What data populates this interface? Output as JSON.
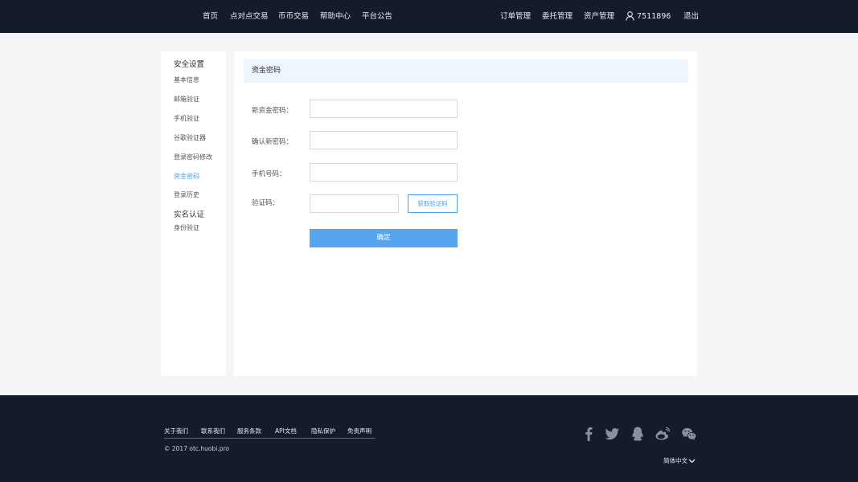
{
  "nav": {
    "left": [
      "首页",
      "点对点交易",
      "币币交易",
      "帮助中心",
      "平台公告"
    ],
    "right": [
      "订单管理",
      "委托管理",
      "资产管理"
    ],
    "user_id": "7511896",
    "logout": "退出"
  },
  "sidebar": {
    "group_security": "安全设置",
    "items": [
      "基本信息",
      "邮箱验证",
      "手机验证",
      "谷歌验证器",
      "登录密码修改",
      "资金密码",
      "登录历史"
    ],
    "active_item": "资金密码",
    "group_identity": "实名认证",
    "identity_items": [
      "身份验证"
    ]
  },
  "form": {
    "title": "资金密码",
    "new_password_label": "新资金密码：",
    "new_password_value": "",
    "confirm_label": "确认新密码：",
    "confirm_value": "",
    "phone_label": "手机号码：",
    "phone_value": "",
    "code_label": "验证码：",
    "code_value": "",
    "get_code_button": "获取验证码",
    "submit_button": "确定"
  },
  "footer": {
    "links": [
      "关于我们",
      "联系我们",
      "服务条款",
      "API文档",
      "隐私保护",
      "免责声明"
    ],
    "copyright": "© 2017 otc.huobi.pro",
    "language": "简体中文",
    "social_icons": [
      "facebook-icon",
      "twitter-icon",
      "qq-icon",
      "weibo-icon",
      "wechat-icon"
    ]
  },
  "colors": {
    "nav_bg": "#141b2b",
    "accent": "#4da0ee",
    "button": "#56a6ef",
    "header_bg": "#eef5fd"
  }
}
